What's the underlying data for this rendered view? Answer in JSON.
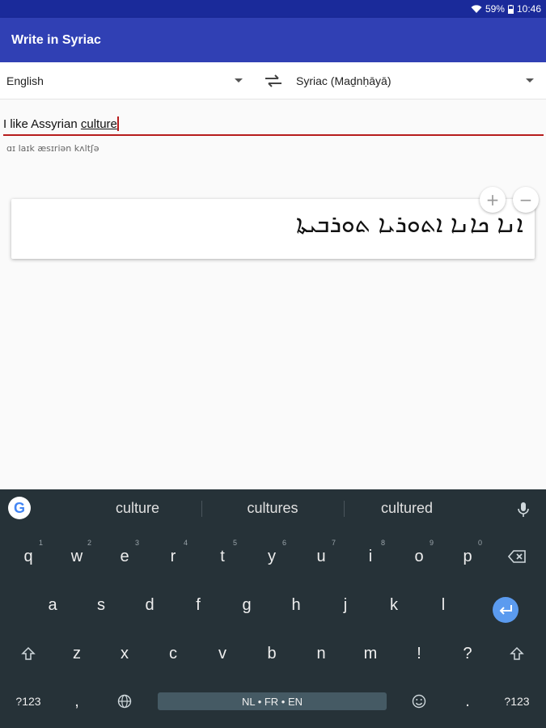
{
  "status_bar": {
    "battery": "59%",
    "time": "10:46"
  },
  "app": {
    "title": "Write in Syriac"
  },
  "languages": {
    "source": "English",
    "target": "Syriac (Maḏnḥāyā)"
  },
  "input": {
    "before": "I like Assyrian ",
    "underlined": "culture"
  },
  "transliteration": "ɑɪ laɪk æsɪriən kʌltʃə",
  "output_text": "ܐܢܐ ܟܐܢܐ ܐܬܘܪܝܐ ܬܘܪܒܝܬܐ",
  "zoom": {
    "in": "+",
    "out": "−"
  },
  "keyboard": {
    "suggestions": [
      "culture",
      "cultures",
      "cultured"
    ],
    "row1": [
      {
        "k": "q",
        "h": "1"
      },
      {
        "k": "w",
        "h": "2"
      },
      {
        "k": "e",
        "h": "3"
      },
      {
        "k": "r",
        "h": "4"
      },
      {
        "k": "t",
        "h": "5"
      },
      {
        "k": "y",
        "h": "6"
      },
      {
        "k": "u",
        "h": "7"
      },
      {
        "k": "i",
        "h": "8"
      },
      {
        "k": "o",
        "h": "9"
      },
      {
        "k": "p",
        "h": "0"
      }
    ],
    "row2": [
      "a",
      "s",
      "d",
      "f",
      "g",
      "h",
      "j",
      "k",
      "l"
    ],
    "row3": [
      "z",
      "x",
      "c",
      "v",
      "b",
      "n",
      "m",
      "!",
      "?"
    ],
    "symbols_label": "?123",
    "comma": ",",
    "period": ".",
    "space_label": "NL • FR • EN"
  },
  "colors": {
    "status_bar": "#1a2a9a",
    "app_bar": "#3040b4",
    "underline": "#b71c1c",
    "keyboard_bg": "#263238",
    "enter": "#5b9bef"
  }
}
